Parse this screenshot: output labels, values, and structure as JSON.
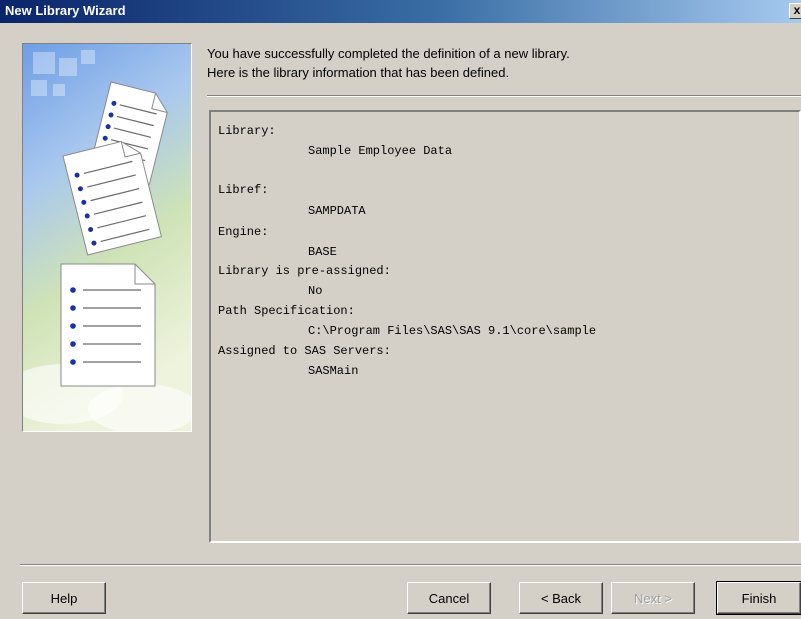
{
  "window": {
    "title": "New Library Wizard",
    "close_glyph": "x"
  },
  "intro": {
    "line1": "You have successfully completed the definition of a new library.",
    "line2": "Here is the library information that has been defined."
  },
  "info": {
    "items": [
      {
        "label": "Library:",
        "value": "Sample Employee Data"
      },
      {
        "label": "Libref:",
        "value": "SAMPDATA"
      },
      {
        "label": "Engine:",
        "value": "BASE"
      },
      {
        "label": "Library is pre-assigned:",
        "value": "No"
      },
      {
        "label": "Path Specification:",
        "value": "C:\\Program Files\\SAS\\SAS 9.1\\core\\sample"
      },
      {
        "label": "Assigned to SAS Servers:",
        "value": "SASMain"
      }
    ]
  },
  "buttons": {
    "help": "Help",
    "cancel": "Cancel",
    "back": "< Back",
    "next": "Next >",
    "finish": "Finish"
  },
  "colors": {
    "titlebar_start": "#0a246a",
    "titlebar_end": "#a6caf0",
    "dialog_bg": "#d4d0c8"
  },
  "icons": {
    "side_graphic": "documents-illustration-icon",
    "close": "close-icon"
  }
}
